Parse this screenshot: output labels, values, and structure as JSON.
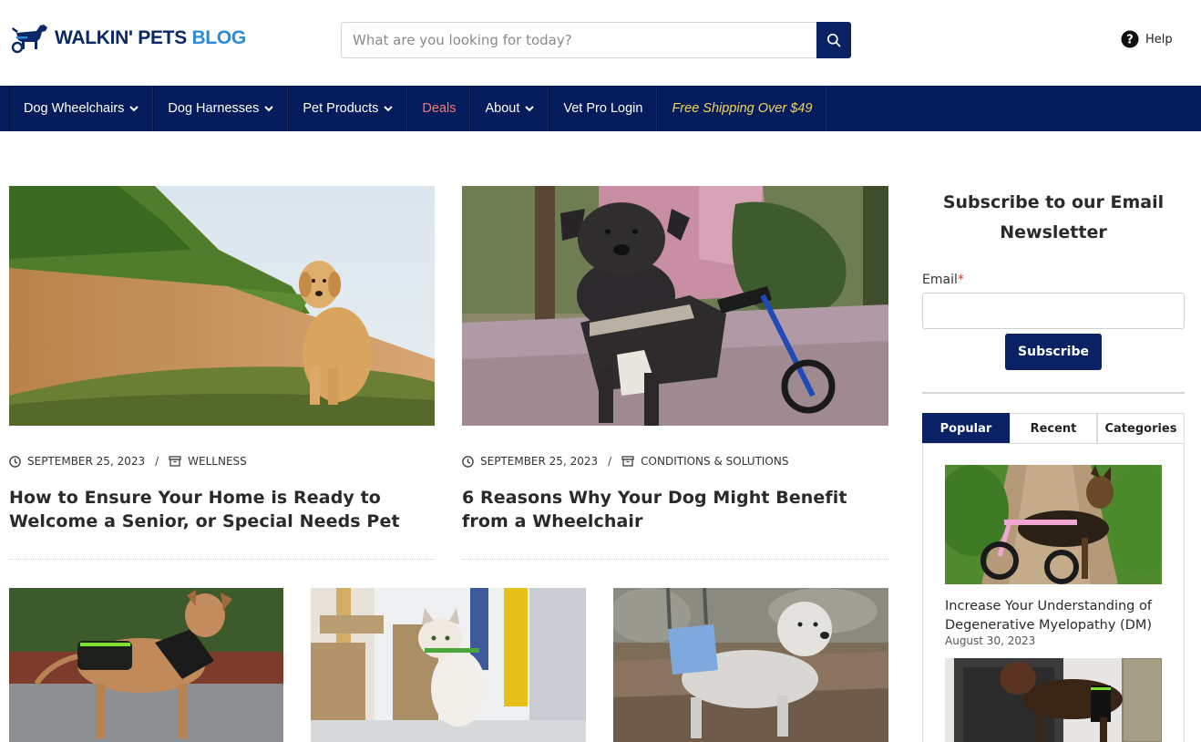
{
  "header": {
    "logo_part1": "WALKIN' PETS ",
    "logo_part2": "BLOG",
    "search_placeholder": "What are you looking for today?",
    "help_label": "Help"
  },
  "nav": {
    "items": [
      {
        "label": "Dog Wheelchairs",
        "dropdown": true
      },
      {
        "label": "Dog Harnesses",
        "dropdown": true
      },
      {
        "label": "Pet Products",
        "dropdown": true
      },
      {
        "label": "Deals",
        "dropdown": false
      },
      {
        "label": "About",
        "dropdown": true
      },
      {
        "label": "Vet Pro Login",
        "dropdown": false
      },
      {
        "label": "Free Shipping Over $49",
        "dropdown": false
      }
    ]
  },
  "posts": [
    {
      "date": "SEPTEMBER 25, 2023",
      "category": "WELLNESS",
      "title": "How to Ensure Your Home is Ready to Welcome a Senior, or Special Needs Pet",
      "image": "golden-retriever-on-hill-photo"
    },
    {
      "date": "SEPTEMBER 25, 2023",
      "category": "CONDITIONS & SOLUTIONS",
      "title": "6 Reasons Why Your Dog Might Benefit from a Wheelchair",
      "image": "dog-in-wheelchair-photo"
    },
    {
      "image": "dog-with-harness-photo"
    },
    {
      "image": "cat-with-toy-photo"
    },
    {
      "image": "small-dog-in-lift-harness-photo"
    }
  ],
  "sidebar": {
    "newsletter_title": "Subscribe to our Email Newsletter",
    "email_label": "Email",
    "required_mark": "*",
    "subscribe_label": "Subscribe",
    "tabs": [
      "Popular",
      "Recent",
      "Categories"
    ],
    "active_tab": "Popular",
    "popular": [
      {
        "title": "Increase Your Understanding of Degenerative Myelopathy (DM)",
        "date": "August 30, 2023",
        "image": "german-shepherd-wheelchair-photo"
      },
      {
        "image": "rottweiler-knee-brace-photo"
      }
    ]
  },
  "colors": {
    "navy": "#041b5c",
    "button_navy": "#0a2163",
    "deals": "#f47b6b",
    "promo": "#f3d55b",
    "logo_blue": "#2d8ad4"
  }
}
